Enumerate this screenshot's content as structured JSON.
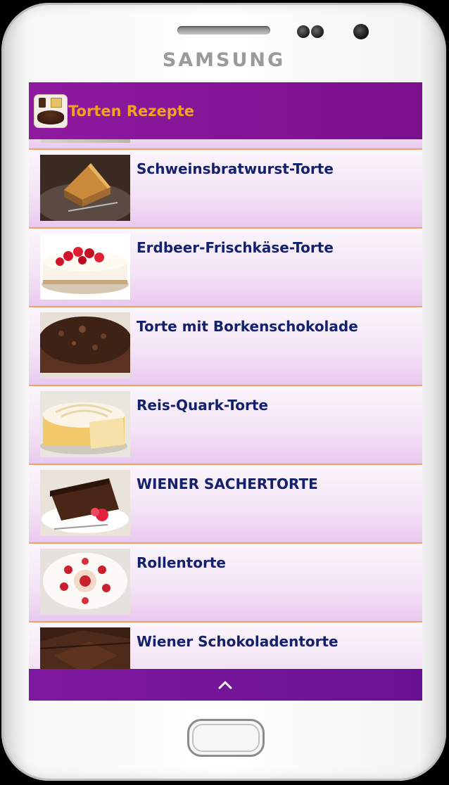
{
  "device": {
    "brand": "SAMSUNG"
  },
  "app": {
    "title": "Torten Rezepte"
  },
  "recipes": [
    {
      "title": "Schweinsbratwurst-Torte",
      "thumb": "cake-slice-photo"
    },
    {
      "title": "Erdbeer-Frischkäse-Torte",
      "thumb": "strawberry-cheesecake-photo"
    },
    {
      "title": "Torte mit Borkenschokolade",
      "thumb": "chocolate-crumble-cake-photo"
    },
    {
      "title": "Reis-Quark-Torte",
      "thumb": "rice-quark-cake-photo"
    },
    {
      "title": "WIENER SACHERTORTE",
      "thumb": "sachertorte-photo"
    },
    {
      "title": "Rollentorte",
      "thumb": "roll-cake-photo"
    },
    {
      "title": "Wiener Schokoladentorte",
      "thumb": "chocolate-cake-photo"
    }
  ],
  "footer": {
    "icon": "chevron-up-icon"
  },
  "colors": {
    "action_bar": "#8e1aa0",
    "title_text": "#f3a21f",
    "item_text": "#13206c",
    "divider": "#f0a35a",
    "bottom_bar": "#7f18a0"
  }
}
